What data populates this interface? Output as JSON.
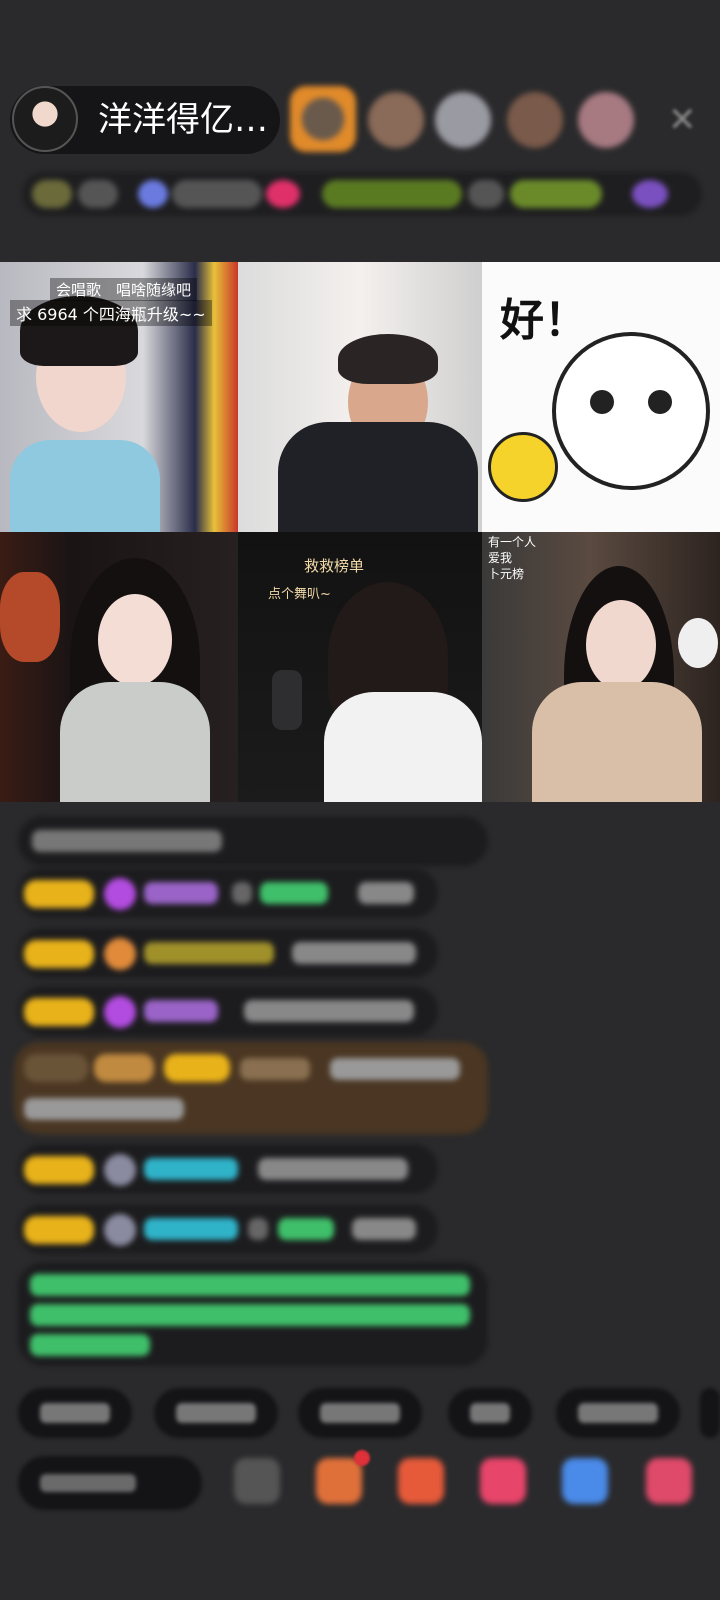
{
  "header": {
    "host_name": "洋洋得亿…",
    "close_icon": "close-icon"
  },
  "grid": {
    "tile1": {
      "caption_top": "会唱歌　唱啥随缘吧",
      "caption_main": "求 6964 个四海瓶升级~~"
    },
    "tile3": {
      "sticker_text": "好！"
    },
    "tile5": {
      "caption_top": "救救榜单",
      "caption_sub": "点个舞叭~"
    },
    "tile6": {
      "caption_line1": "有一个人",
      "caption_line2": "爱我",
      "caption_line3": "卜元榜"
    }
  },
  "colors": {
    "background": "#2a2a2c",
    "badge_gold": "#e8b21a",
    "gem_purple": "#b24ce0",
    "chat_green": "#3fbf6a",
    "chat_cyan": "#2fb3c9"
  }
}
